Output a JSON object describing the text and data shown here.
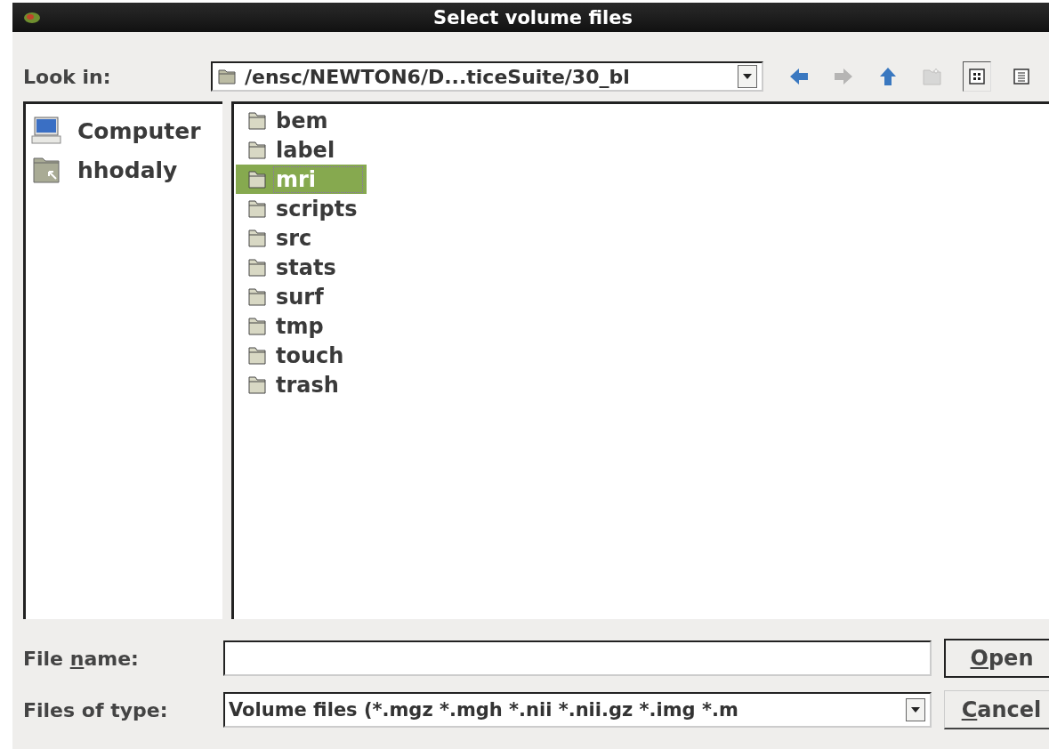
{
  "window": {
    "title": "Select volume files"
  },
  "look_in": {
    "label": "Look in:",
    "value": "/ensc/NEWTON6/D...ticeSuite/30_bl"
  },
  "toolbar": [
    {
      "kind": "back",
      "disabled": false,
      "selected": false
    },
    {
      "kind": "forward",
      "disabled": true,
      "selected": false
    },
    {
      "kind": "up",
      "disabled": false,
      "selected": false
    },
    {
      "kind": "new-folder",
      "disabled": true,
      "selected": false
    },
    {
      "kind": "icon-view",
      "disabled": false,
      "selected": true
    },
    {
      "kind": "list-view",
      "disabled": false,
      "selected": false
    }
  ],
  "places": [
    {
      "kind": "computer",
      "label": "Computer"
    },
    {
      "kind": "home",
      "label": "hhodaly"
    }
  ],
  "files": [
    {
      "name": "bem",
      "selected": false
    },
    {
      "name": "label",
      "selected": false
    },
    {
      "name": "mri",
      "selected": true
    },
    {
      "name": "scripts",
      "selected": false
    },
    {
      "name": "src",
      "selected": false
    },
    {
      "name": "stats",
      "selected": false
    },
    {
      "name": "surf",
      "selected": false
    },
    {
      "name": "tmp",
      "selected": false
    },
    {
      "name": "touch",
      "selected": false
    },
    {
      "name": "trash",
      "selected": false
    }
  ],
  "file_name": {
    "label": "File name:"
  },
  "files_of_type": {
    "label": "Files of type:",
    "value": "Volume files (*.mgz *.mgh *.nii *.nii.gz *.img *.m"
  },
  "buttons": [
    {
      "label": "Open",
      "kind": "default"
    },
    {
      "label": "Cancel",
      "kind": "normal"
    }
  ]
}
